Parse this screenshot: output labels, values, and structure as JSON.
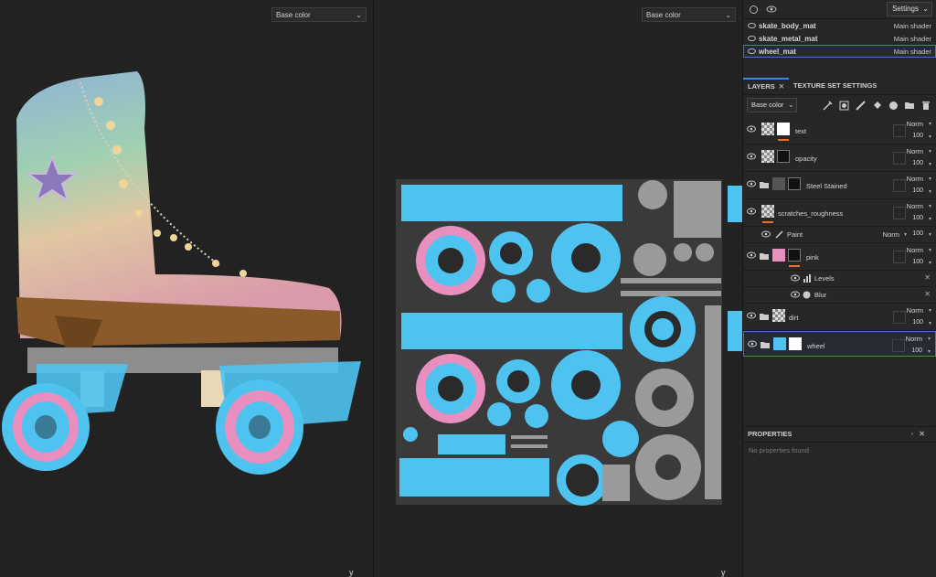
{
  "viewport3d": {
    "channel": "Base color",
    "axis_label": "y"
  },
  "viewport2d": {
    "channel": "Base color",
    "axis_label": "y"
  },
  "topbar": {
    "settings_label": "Settings"
  },
  "texture_sets": [
    {
      "name": "skate_body_mat",
      "shader": "Main shader"
    },
    {
      "name": "skate_metal_mat",
      "shader": "Main shader"
    },
    {
      "name": "wheel_mat",
      "shader": "Main shader",
      "selected": true
    }
  ],
  "tabs": {
    "layers": "LAYERS",
    "close": "✕",
    "texture_set_settings": "TEXTURE SET SETTINGS"
  },
  "layers_toolbar": {
    "channel": "Base color"
  },
  "layers": [
    {
      "name": "text",
      "blend": "Norm",
      "opacity": "100"
    },
    {
      "name": "opacity",
      "blend": "Norm",
      "opacity": "100"
    },
    {
      "name": "Steel Stained",
      "blend": "Norm",
      "opacity": "100"
    },
    {
      "name": "scratches_roughness",
      "blend": "Norm",
      "opacity": "100"
    },
    {
      "name": "Paint",
      "blend": "Norm",
      "opacity": "100"
    },
    {
      "name": "pink",
      "blend": "Norm",
      "opacity": "100"
    },
    {
      "name": "Levels"
    },
    {
      "name": "Blur"
    },
    {
      "name": "dirt",
      "blend": "Norm",
      "opacity": "100"
    },
    {
      "name": "wheel",
      "blend": "Norm",
      "opacity": "100"
    }
  ],
  "properties": {
    "title": "PROPERTIES",
    "empty": "No properties found"
  },
  "colors": {
    "accent": "#3f89d6",
    "orange_mask": "#e8742a",
    "wheel_blue": "#4fc3ef",
    "wheel_pink": "#e98fbf"
  }
}
